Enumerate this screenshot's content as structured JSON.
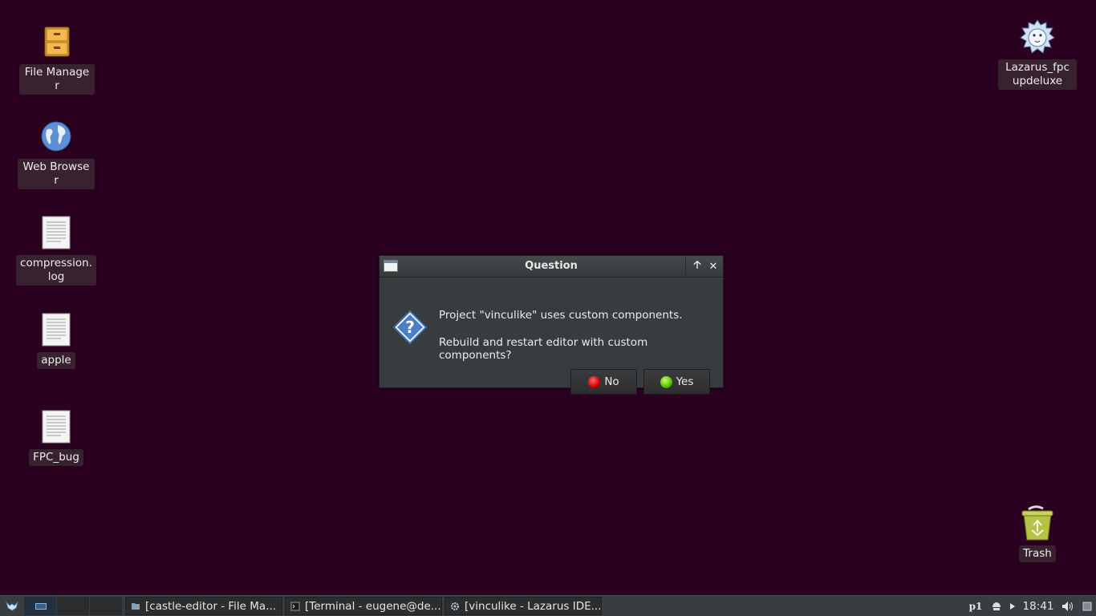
{
  "desktop": {
    "icons": [
      {
        "label": "File Manager",
        "icon": "file-cabinet-icon"
      },
      {
        "label": "Web Browser",
        "icon": "globe-icon"
      },
      {
        "label": "compression.log",
        "icon": "text-file-icon"
      },
      {
        "label": "apple",
        "icon": "text-file-icon"
      },
      {
        "label": "FPC_bug",
        "icon": "text-file-icon"
      },
      {
        "label": "Lazarus_fpcupdeluxe",
        "icon": "cheetah-icon"
      },
      {
        "label": "Trash",
        "icon": "trash-icon"
      }
    ]
  },
  "dialog": {
    "title": "Question",
    "message1": "Project \"vinculike\" uses custom components.",
    "message2": "Rebuild and restart editor with custom components?",
    "no_label": "No",
    "yes_label": "Yes",
    "maximize_glyph": "🡡",
    "close_glyph": "✕"
  },
  "taskbar": {
    "tasks": [
      {
        "label": "[castle-editor - File Ma...",
        "icon": "folder-icon"
      },
      {
        "label": "[Terminal - eugene@de...",
        "icon": "terminal-icon"
      },
      {
        "label": "[vinculike - Lazarus IDE...",
        "icon": "gear-icon"
      }
    ],
    "keyboard_layout": "p1",
    "clock": "18:41"
  },
  "colors": {
    "desktop_bg": "#2a0220",
    "dialog_bg": "#393c3e",
    "taskbar_bg": "#3a3d3f"
  }
}
